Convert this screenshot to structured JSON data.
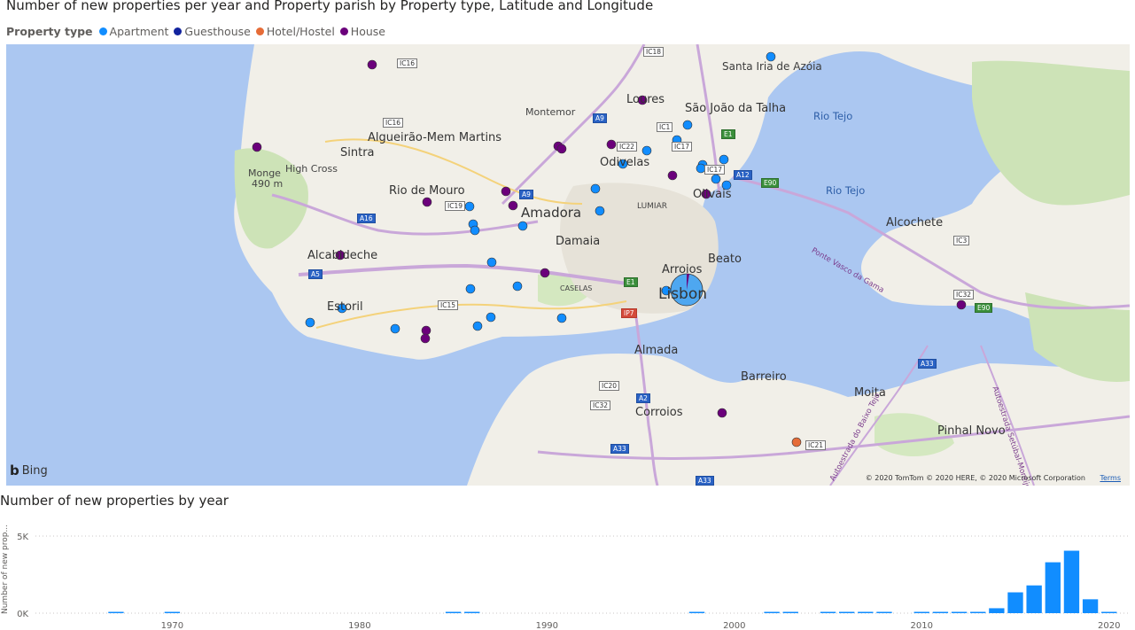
{
  "map_visual": {
    "title": "Number of new properties per year and Property parish by Property type, Latitude and Longitude",
    "legend": {
      "title": "Property type",
      "items": [
        {
          "label": "Apartment",
          "color": "#118dff"
        },
        {
          "label": "Guesthouse",
          "color": "#12239e"
        },
        {
          "label": "Hotel/Hostel",
          "color": "#e66c37"
        },
        {
          "label": "House",
          "color": "#6b007b"
        }
      ]
    },
    "places": [
      "Santa Iria de Azóia",
      "Loures",
      "São João da Talha",
      "Montemor",
      "Algueirão-Mem Martins",
      "Sintra",
      "High Cross",
      "Monge",
      "490 m",
      "Odivelas",
      "Rio de Mouro",
      "Amadora",
      "LUMIAR",
      "Olivais",
      "Damaia",
      "Alcabideche",
      "Arroios",
      "Beato",
      "Lisbon",
      "Estoril",
      "CASELAS",
      "Almada",
      "Barreiro",
      "Moita",
      "Corroios",
      "Pinhal Novo",
      "Alcochete",
      "Rio Tejo",
      "Rio Tejo",
      "Ponte Vasco da Gama",
      "Autoestrada do Baixo Tejo",
      "Autoestrada Setúbal-Montijo"
    ],
    "road_labels": [
      "IC16",
      "IC18",
      "IC16",
      "A9",
      "IC22",
      "IC1",
      "IC17",
      "E1",
      "IC17",
      "A12",
      "E90",
      "A9",
      "IC19",
      "A16",
      "A5",
      "IC15",
      "E1",
      "IP7",
      "IC20",
      "A2",
      "IC32",
      "A33",
      "A33",
      "IC3",
      "IC32",
      "E90",
      "A33",
      "IC21"
    ],
    "brand": "Bing",
    "attribution": "© 2020 TomTom © 2020 HERE, © 2020 Microsoft Corporation",
    "terms": "Terms"
  },
  "chart_data": {
    "type": "bar",
    "title": "Number of new properties by year",
    "xlabel": "",
    "ylabel": "Number of new prop...",
    "x_ticks": [
      "1970",
      "1980",
      "1990",
      "2000",
      "2010",
      "2020"
    ],
    "y_ticks": [
      "0K",
      "5K"
    ],
    "ylim": [
      0,
      5000
    ],
    "xlim": [
      1962,
      2021
    ],
    "bar_color": "#118dff",
    "grid": "horizontal dotted",
    "categories": [
      1967,
      1970,
      1985,
      1986,
      1998,
      2002,
      2003,
      2005,
      2006,
      2007,
      2008,
      2010,
      2011,
      2012,
      2013,
      2014,
      2015,
      2016,
      2017,
      2018,
      2019,
      2020
    ],
    "values": [
      40,
      40,
      40,
      40,
      40,
      40,
      40,
      40,
      40,
      40,
      40,
      40,
      40,
      40,
      80,
      320,
      1350,
      1800,
      3300,
      4050,
      900,
      60
    ]
  }
}
